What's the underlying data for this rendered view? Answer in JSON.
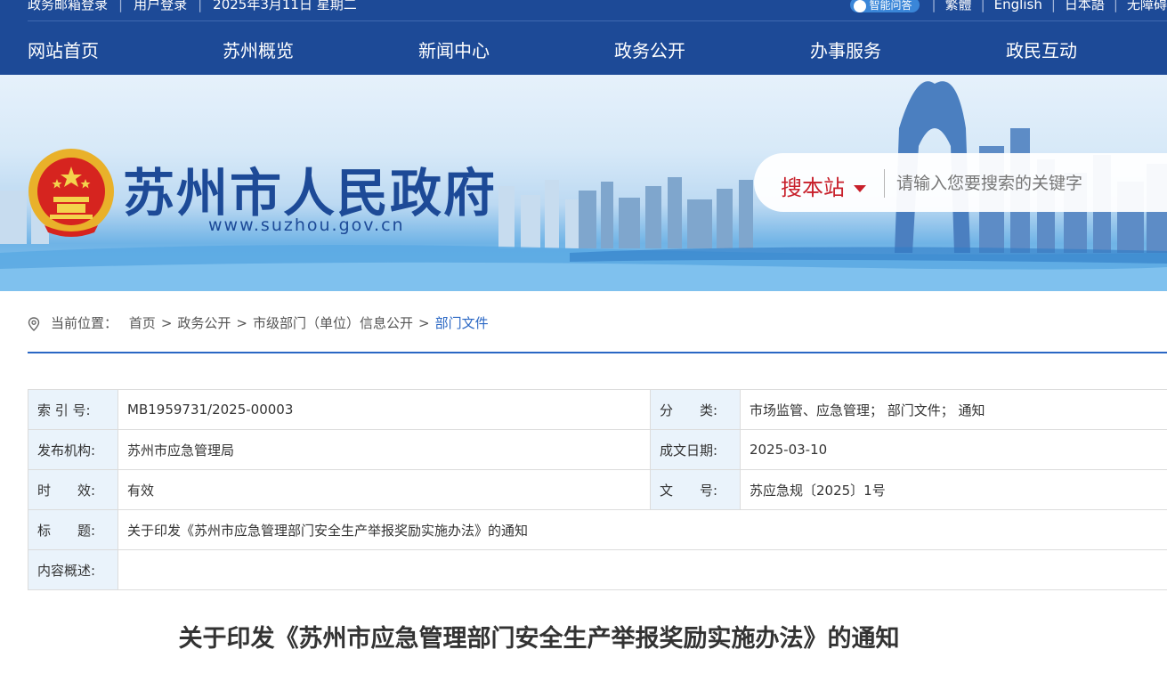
{
  "topbar": {
    "left": [
      "政务邮箱登录",
      "用户登录",
      "2025年3月11日 星期二"
    ],
    "ai_label": "智能问答",
    "right": [
      "繁體",
      "English",
      "日本語",
      "无障碍"
    ]
  },
  "nav": [
    "网站首页",
    "苏州概览",
    "新闻中心",
    "政务公开",
    "办事服务",
    "政民互动"
  ],
  "banner": {
    "title": "苏州市人民政府",
    "url": "www.suzhou.gov.cn"
  },
  "search": {
    "scope": "搜本站",
    "placeholder": "请输入您要搜索的关键字"
  },
  "breadcrumb": {
    "label": "当前位置：",
    "items": [
      "首页",
      "政务公开",
      "市级部门（单位）信息公开",
      "部门文件"
    ],
    "sep": ">"
  },
  "meta": {
    "index_label": "索 引 号:",
    "index_value": "MB1959731/2025-00003",
    "category_label": "分　　类:",
    "category_value": "市场监管、应急管理；  部门文件；  通知",
    "publisher_label": "发布机构:",
    "publisher_value": "苏州市应急管理局",
    "date_label": "成文日期:",
    "date_value": "2025-03-10",
    "validity_label": "时　　效:",
    "validity_value": "有效",
    "docno_label": "文　　号:",
    "docno_value": "苏应急规〔2025〕1号",
    "title_label": "标　　题:",
    "title_value": "关于印发《苏州市应急管理部门安全生产举报奖励实施办法》的通知",
    "summary_label": "内容概述:",
    "summary_value": ""
  },
  "article": {
    "title": "关于印发《苏州市应急管理部门安全生产举报奖励实施办法》的通知"
  },
  "colors": {
    "brand_blue": "#1d4a97",
    "accent_red": "#c8202b",
    "link_blue": "#2a67c4",
    "table_label_bg": "#eaf3fb"
  }
}
